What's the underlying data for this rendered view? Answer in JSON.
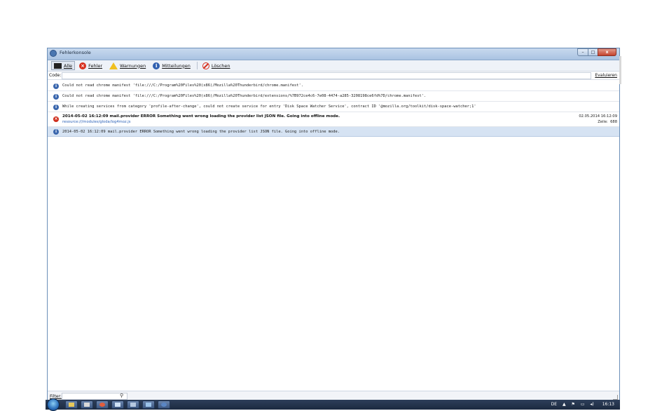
{
  "window": {
    "title": "Fehlerkonsole",
    "caption_buttons": {
      "minimize": "–",
      "maximize": "□",
      "close": "x"
    }
  },
  "toolbar": {
    "all_label": "Alle",
    "errors_label": "Fehler",
    "warnings_label": "Warnungen",
    "messages_label": "Mitteilungen",
    "clear_label": "Löschen"
  },
  "code": {
    "label": "Code:",
    "value": "",
    "evaluate_label": "Evaluieren"
  },
  "messages": [
    {
      "type": "message",
      "text": "Could not read chrome manifest 'file:///C:/Program%20Files%20(x86)/Mozilla%20Thunderbird/chrome.manifest'."
    },
    {
      "type": "message",
      "text": "Could not read chrome manifest 'file:///C:/Program%20Files%20(x86)/Mozilla%20Thunderbird/extensions/%7B972ce4c6-7e08-4474-a285-3208198ce6fd%7D/chrome.manifest'."
    },
    {
      "type": "message",
      "text": "While creating services from category 'profile-after-change', could not create service for entry 'Disk Space Watcher Service', contract ID '@mozilla.org/toolkit/disk-space-watcher;1'"
    },
    {
      "type": "error",
      "text": "2014-05-02 16:12:09 mail.provider    ERROR  Something went wrong loading the provider list JSON file. Going into offline mode.",
      "source": "resource:///modules/gloda/log4moz.js",
      "date": "02.05.2014 16:12:09",
      "line_label": "Zeile:",
      "line": "688"
    },
    {
      "type": "message",
      "selected": true,
      "text": "2014-05-02 16:12:09    mail.provider   ERROR   Something went wrong loading the provider list JSON file. Going into offline mode."
    }
  ],
  "filter": {
    "label": "Filter:",
    "value": ""
  },
  "taskbar": {
    "tray_lang": "DE",
    "clock": "16:13"
  },
  "colors": {
    "selected_row": "#d6e3f3",
    "error_icon": "#cf2f1e",
    "message_icon": "#3a66ad",
    "link": "#2d62b8"
  }
}
